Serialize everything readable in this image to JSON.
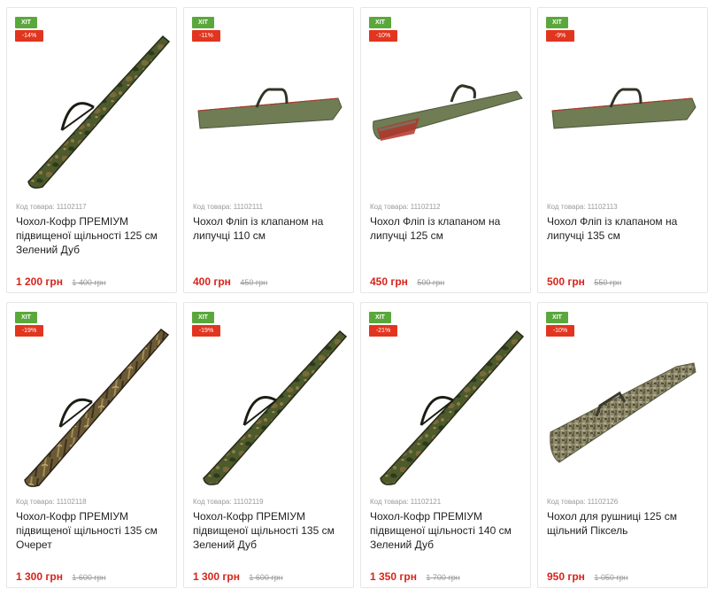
{
  "products": [
    {
      "badge": "ХІТ",
      "discount": "-14%",
      "code": "Код товара: 11102117",
      "title": "Чохол-Кофр ПРЕМІУМ підвищеної щільності 125 см Зелений Дуб",
      "price": "1 200 грн",
      "old_price": "1 400 грн",
      "image": "camo-oak-case-icon",
      "color": "#4d5a2c"
    },
    {
      "badge": "ХІТ",
      "discount": "-11%",
      "code": "Код товара: 11102111",
      "title": "Чохол Фліп із клапаном на липучці 110 см",
      "price": "400 грн",
      "old_price": "450 грн",
      "image": "olive-flip-case-icon",
      "color": "#6f7c54"
    },
    {
      "badge": "ХІТ",
      "discount": "-10%",
      "code": "Код товара: 11102112",
      "title": "Чохол Фліп із клапаном на липучці 125 см",
      "price": "450 грн",
      "old_price": "500 грн",
      "image": "olive-flip-case-open-icon",
      "color": "#6f7c54"
    },
    {
      "badge": "ХІТ",
      "discount": "-9%",
      "code": "Код товара: 11102113",
      "title": "Чохол Фліп із клапаном на липучці 135 см",
      "price": "500 грн",
      "old_price": "550 грн",
      "image": "olive-flip-case-icon",
      "color": "#6f7c54"
    },
    {
      "badge": "ХІТ",
      "discount": "-19%",
      "code": "Код товара: 11102118",
      "title": "Чохол-Кофр ПРЕМІУМ підвищеної щільності 135 см Очерет",
      "price": "1 300 грн",
      "old_price": "1 600 грн",
      "image": "camo-reed-case-icon",
      "color": "#6b5a36"
    },
    {
      "badge": "ХІТ",
      "discount": "-19%",
      "code": "Код товара: 11102119",
      "title": "Чохол-Кофр ПРЕМІУМ підвищеної щільності 135 см Зелений Дуб",
      "price": "1 300 грн",
      "old_price": "1 600 грн",
      "image": "camo-oak-case-icon",
      "color": "#4d5a2c"
    },
    {
      "badge": "ХІТ",
      "discount": "-21%",
      "code": "Код товара: 11102121",
      "title": "Чохол-Кофр ПРЕМІУМ підвищеної щільності 140 см Зелений Дуб",
      "price": "1 350 грн",
      "old_price": "1 700 грн",
      "image": "camo-oak-case-icon",
      "color": "#4d5a2c"
    },
    {
      "badge": "ХІТ",
      "discount": "-10%",
      "code": "Код товара: 11102126",
      "title": "Чохол для рушниці 125 см щільний Піксель",
      "price": "950 грн",
      "old_price": "1 050 грн",
      "image": "pixel-camo-case-icon",
      "color": "#8f8a6c"
    }
  ]
}
